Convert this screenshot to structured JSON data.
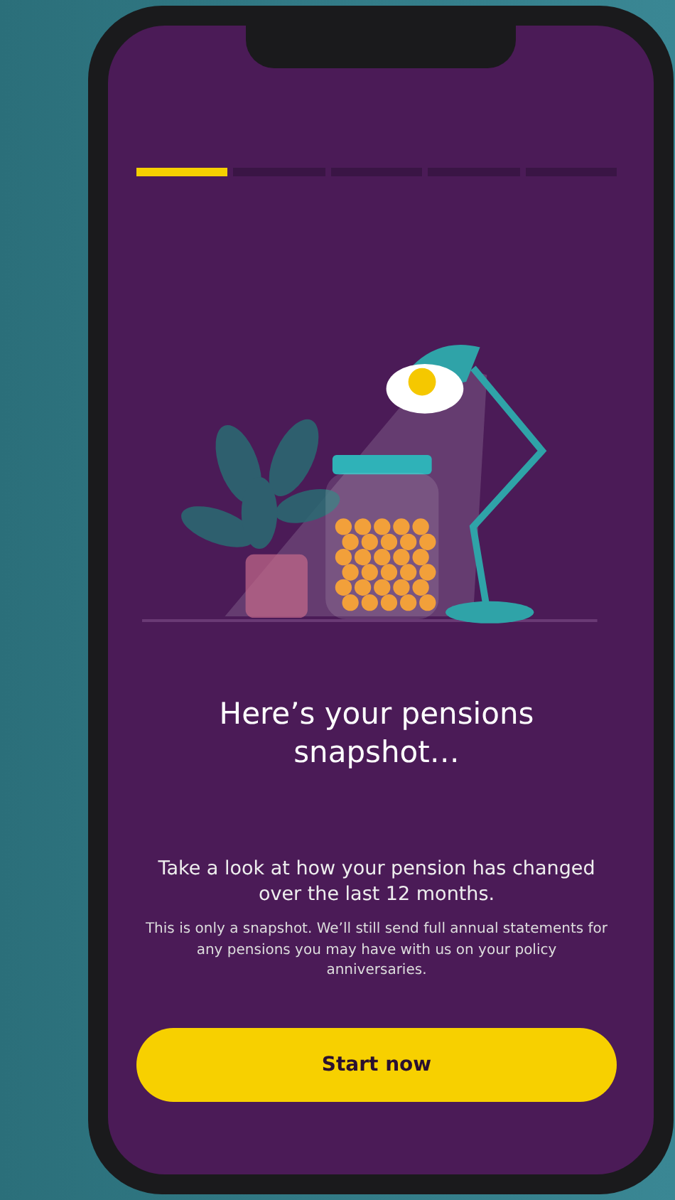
{
  "progress": {
    "steps": [
      {
        "selected": true
      },
      {
        "selected": false
      },
      {
        "selected": false
      },
      {
        "selected": false
      },
      {
        "selected": false
      }
    ]
  },
  "title": "Here’s your pensions snapshot…",
  "intro": "Take a look at how your pension has changed over the last 12 months.",
  "note": "This is only a snapshot. We’ll still send full annual statements for any pensions you may have with us on your policy anniversaries.",
  "button": "Start now"
}
